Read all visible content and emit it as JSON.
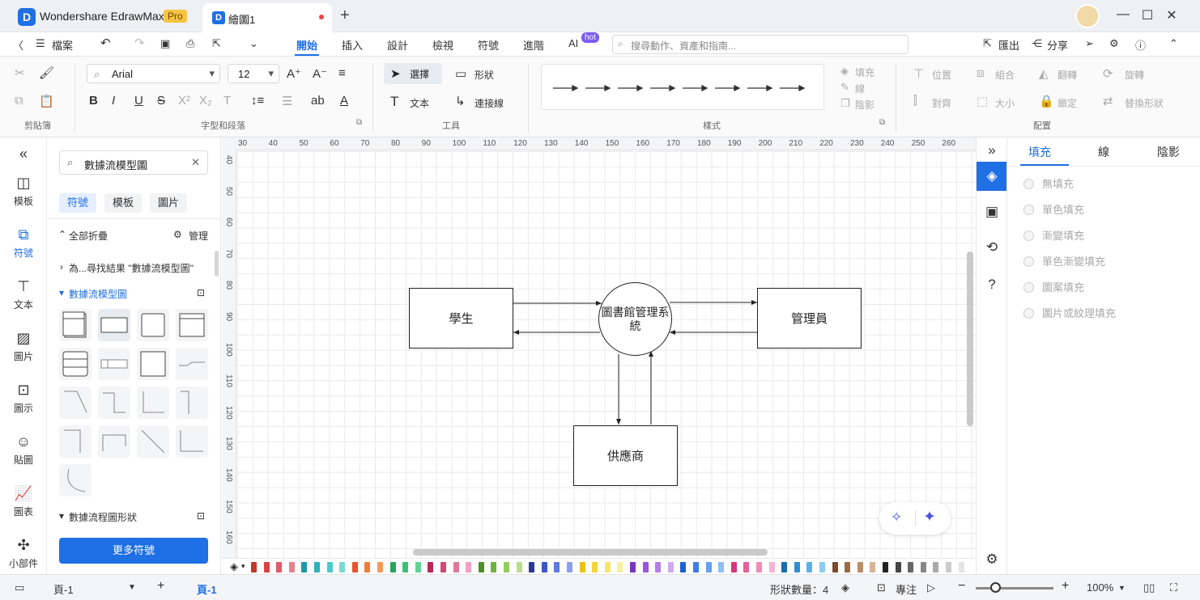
{
  "titlebar": {
    "app_name": "Wondershare EdrawMax",
    "pro_badge": "Pro",
    "doc_tab": "繪圖1",
    "new_tab": "+",
    "minimize": "—",
    "maximize": "☐",
    "close": "✕"
  },
  "menubar": {
    "back": "〈",
    "file": "檔案",
    "undo": "↶",
    "redo": "↷",
    "tabs": [
      "開始",
      "插入",
      "設計",
      "檢視",
      "符號",
      "進階",
      "AI"
    ],
    "hot_badge": "hot",
    "search_placeholder": "搜尋動作、資產和指南...",
    "export": "匯出",
    "share": "分享"
  },
  "ribbon": {
    "font_name": "Arial",
    "font_size": "12",
    "select": "選擇",
    "shape": "形狀",
    "text": "文本",
    "connector": "連接線",
    "fill": "填充",
    "line": "線",
    "shadow": "陰影",
    "position": "位置",
    "group": "組合",
    "flip": "翻轉",
    "rotate": "旋轉",
    "align": "對齊",
    "size": "大小",
    "lock": "鎖定",
    "replace_shape": "替換形狀",
    "groups": [
      "剪貼簿",
      "字型和段落",
      "工具",
      "樣式",
      "配置"
    ]
  },
  "leftrail": {
    "items": [
      {
        "label": "模板",
        "icon": "template-icon"
      },
      {
        "label": "符號",
        "icon": "symbol-icon"
      },
      {
        "label": "文本",
        "icon": "text-icon"
      },
      {
        "label": "圖片",
        "icon": "image-icon"
      },
      {
        "label": "圖示",
        "icon": "icon-library-icon"
      },
      {
        "label": "貼圖",
        "icon": "sticker-icon"
      },
      {
        "label": "圖表",
        "icon": "chart-icon"
      },
      {
        "label": "小部件",
        "icon": "widget-icon"
      }
    ]
  },
  "library": {
    "search_value": "數據流模型圖",
    "tabs": [
      "符號",
      "模板",
      "圖片"
    ],
    "collapse_all": "全部折疊",
    "manage": "管理",
    "result_row": "為...尋找結果 \"數據流模型圖\"",
    "section1": "數據流模型圖",
    "section2": "數據流程圖形狀",
    "more_button": "更多符號"
  },
  "ruler": {
    "x_ticks": [
      "30",
      "40",
      "50",
      "60",
      "70",
      "80",
      "90",
      "100",
      "110",
      "120",
      "130",
      "140",
      "150",
      "160",
      "170",
      "180",
      "190",
      "200",
      "210",
      "220",
      "230",
      "240",
      "250",
      "260"
    ],
    "y_ticks": [
      "40",
      "50",
      "60",
      "70",
      "80",
      "90",
      "100",
      "110",
      "120",
      "130",
      "140",
      "150",
      "160"
    ]
  },
  "diagram": {
    "student": "學生",
    "system": "圖書館管理系統",
    "admin": "管理員",
    "supplier": "供應商"
  },
  "properties": {
    "tabs": [
      "填充",
      "線",
      "陰影"
    ],
    "options": [
      "無填充",
      "單色填充",
      "漸變填充",
      "單色漸變填充",
      "圖案填充",
      "圖片或紋理填充"
    ]
  },
  "palette": {
    "colors": [
      "#c0392b",
      "#d64545",
      "#e05a6a",
      "#e8808e",
      "#1a9aa0",
      "#2bb3b8",
      "#4cc9c9",
      "#7bd8d4",
      "#e8542b",
      "#f07c3a",
      "#f39c5a",
      "#26a65b",
      "#3cbf74",
      "#62d193",
      "#b7295a",
      "#d44878",
      "#e57499",
      "#f2a0bd",
      "#4a8f2a",
      "#6cb33f",
      "#93cc5c",
      "#b8de86",
      "#2a3aa0",
      "#3e56c4",
      "#5f7ae0",
      "#8aa0ee",
      "#e8c21a",
      "#f2d43c",
      "#f7e46b",
      "#faf09b",
      "#7a35c4",
      "#9a55de",
      "#b67ee8",
      "#d2a8f1",
      "#1f5fcf",
      "#3a7de6",
      "#62a0f0",
      "#8fc0f6",
      "#d4367e",
      "#e45f9b",
      "#ef8bb8",
      "#f6b4d2",
      "#1a6fa8",
      "#2e8fcf",
      "#5cb0e6",
      "#8ccdf2",
      "#7a4a2a",
      "#9a6a42",
      "#b88e68",
      "#d6b494",
      "#222222",
      "#444444",
      "#666666",
      "#888888",
      "#aaaaaa",
      "#cccccc",
      "#e5e5e5"
    ]
  },
  "statusbar": {
    "page_selector": "頁-1",
    "add_page": "+",
    "current_page": "頁-1",
    "shape_count": "形狀數量：4",
    "focus": "專注",
    "zoom_minus": "−",
    "zoom_plus": "+",
    "zoom_level": "100%"
  }
}
